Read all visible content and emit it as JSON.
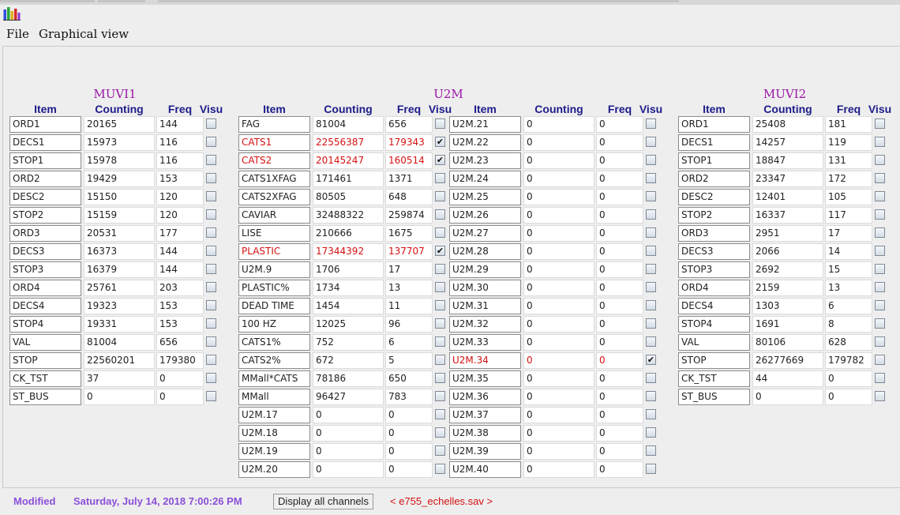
{
  "menu": {
    "file": "File",
    "graphical_view": "Graphical view"
  },
  "col_headers": {
    "item": "Item",
    "counting": "Counting",
    "freq": "Freq",
    "visu": "Visu"
  },
  "sections": [
    {
      "title": "MUVI1",
      "groups": [
        {
          "rows": [
            {
              "item": "ORD1",
              "counting": "20165",
              "freq": "144",
              "checked": false,
              "red": false
            },
            {
              "item": "DECS1",
              "counting": "15973",
              "freq": "116",
              "checked": false,
              "red": false
            },
            {
              "item": "STOP1",
              "counting": "15978",
              "freq": "116",
              "checked": false,
              "red": false
            },
            {
              "item": "ORD2",
              "counting": "19429",
              "freq": "153",
              "checked": false,
              "red": false
            },
            {
              "item": "DESC2",
              "counting": "15150",
              "freq": "120",
              "checked": false,
              "red": false
            },
            {
              "item": "STOP2",
              "counting": "15159",
              "freq": "120",
              "checked": false,
              "red": false
            },
            {
              "item": "ORD3",
              "counting": "20531",
              "freq": "177",
              "checked": false,
              "red": false
            },
            {
              "item": "DECS3",
              "counting": "16373",
              "freq": "144",
              "checked": false,
              "red": false
            },
            {
              "item": "STOP3",
              "counting": "16379",
              "freq": "144",
              "checked": false,
              "red": false
            },
            {
              "item": "ORD4",
              "counting": "25761",
              "freq": "203",
              "checked": false,
              "red": false
            },
            {
              "item": "DECS4",
              "counting": "19323",
              "freq": "153",
              "checked": false,
              "red": false
            },
            {
              "item": "STOP4",
              "counting": "19331",
              "freq": "153",
              "checked": false,
              "red": false
            },
            {
              "item": "VAL",
              "counting": "81004",
              "freq": "656",
              "checked": false,
              "red": false
            },
            {
              "item": "STOP",
              "counting": "22560201",
              "freq": "179380",
              "checked": false,
              "red": false
            },
            {
              "item": "CK_TST",
              "counting": "37",
              "freq": "0",
              "checked": false,
              "red": false
            },
            {
              "item": "ST_BUS",
              "counting": "0",
              "freq": "0",
              "checked": false,
              "red": false
            }
          ]
        }
      ]
    },
    {
      "title": "U2M",
      "groups": [
        {
          "rows": [
            {
              "item": "FAG",
              "counting": "81004",
              "freq": "656",
              "checked": false,
              "red": false
            },
            {
              "item": "CATS1",
              "counting": "22556387",
              "freq": "179343",
              "checked": true,
              "red": true
            },
            {
              "item": "CATS2",
              "counting": "20145247",
              "freq": "160514",
              "checked": true,
              "red": true
            },
            {
              "item": "CATS1XFAG",
              "counting": "171461",
              "freq": "1371",
              "checked": false,
              "red": false
            },
            {
              "item": "CATS2XFAG",
              "counting": "80505",
              "freq": "648",
              "checked": false,
              "red": false
            },
            {
              "item": "CAVIAR",
              "counting": "32488322",
              "freq": "259874",
              "checked": false,
              "red": false
            },
            {
              "item": "LISE",
              "counting": "210666",
              "freq": "1675",
              "checked": false,
              "red": false
            },
            {
              "item": "PLASTIC",
              "counting": "17344392",
              "freq": "137707",
              "checked": true,
              "red": true
            },
            {
              "item": "U2M.9",
              "counting": "1706",
              "freq": "17",
              "checked": false,
              "red": false
            },
            {
              "item": "PLASTIC%",
              "counting": "1734",
              "freq": "13",
              "checked": false,
              "red": false
            },
            {
              "item": "DEAD TIME",
              "counting": "1454",
              "freq": "11",
              "checked": false,
              "red": false
            },
            {
              "item": "100 HZ",
              "counting": "12025",
              "freq": "96",
              "checked": false,
              "red": false
            },
            {
              "item": "CATS1%",
              "counting": "752",
              "freq": "6",
              "checked": false,
              "red": false
            },
            {
              "item": "CATS2%",
              "counting": "672",
              "freq": "5",
              "checked": false,
              "red": false
            },
            {
              "item": "MMall*CATS",
              "counting": "78186",
              "freq": "650",
              "checked": false,
              "red": false
            },
            {
              "item": "MMall",
              "counting": "96427",
              "freq": "783",
              "checked": false,
              "red": false
            },
            {
              "item": "U2M.17",
              "counting": "0",
              "freq": "0",
              "checked": false,
              "red": false
            },
            {
              "item": "U2M.18",
              "counting": "0",
              "freq": "0",
              "checked": false,
              "red": false
            },
            {
              "item": "U2M.19",
              "counting": "0",
              "freq": "0",
              "checked": false,
              "red": false
            },
            {
              "item": "U2M.20",
              "counting": "0",
              "freq": "0",
              "checked": false,
              "red": false
            }
          ]
        },
        {
          "rows": [
            {
              "item": "U2M.21",
              "counting": "0",
              "freq": "0",
              "checked": false,
              "red": false
            },
            {
              "item": "U2M.22",
              "counting": "0",
              "freq": "0",
              "checked": false,
              "red": false
            },
            {
              "item": "U2M.23",
              "counting": "0",
              "freq": "0",
              "checked": false,
              "red": false
            },
            {
              "item": "U2M.24",
              "counting": "0",
              "freq": "0",
              "checked": false,
              "red": false
            },
            {
              "item": "U2M.25",
              "counting": "0",
              "freq": "0",
              "checked": false,
              "red": false
            },
            {
              "item": "U2M.26",
              "counting": "0",
              "freq": "0",
              "checked": false,
              "red": false
            },
            {
              "item": "U2M.27",
              "counting": "0",
              "freq": "0",
              "checked": false,
              "red": false
            },
            {
              "item": "U2M.28",
              "counting": "0",
              "freq": "0",
              "checked": false,
              "red": false
            },
            {
              "item": "U2M.29",
              "counting": "0",
              "freq": "0",
              "checked": false,
              "red": false
            },
            {
              "item": "U2M.30",
              "counting": "0",
              "freq": "0",
              "checked": false,
              "red": false
            },
            {
              "item": "U2M.31",
              "counting": "0",
              "freq": "0",
              "checked": false,
              "red": false
            },
            {
              "item": "U2M.32",
              "counting": "0",
              "freq": "0",
              "checked": false,
              "red": false
            },
            {
              "item": "U2M.33",
              "counting": "0",
              "freq": "0",
              "checked": false,
              "red": false
            },
            {
              "item": "U2M.34",
              "counting": "0",
              "freq": "0",
              "checked": true,
              "red": true
            },
            {
              "item": "U2M.35",
              "counting": "0",
              "freq": "0",
              "checked": false,
              "red": false
            },
            {
              "item": "U2M.36",
              "counting": "0",
              "freq": "0",
              "checked": false,
              "red": false
            },
            {
              "item": "U2M.37",
              "counting": "0",
              "freq": "0",
              "checked": false,
              "red": false
            },
            {
              "item": "U2M.38",
              "counting": "0",
              "freq": "0",
              "checked": false,
              "red": false
            },
            {
              "item": "U2M.39",
              "counting": "0",
              "freq": "0",
              "checked": false,
              "red": false
            },
            {
              "item": "U2M.40",
              "counting": "0",
              "freq": "0",
              "checked": false,
              "red": false
            }
          ]
        }
      ]
    },
    {
      "title": "MUVI2",
      "groups": [
        {
          "rows": [
            {
              "item": "ORD1",
              "counting": "25408",
              "freq": "181",
              "checked": false,
              "red": false
            },
            {
              "item": "DECS1",
              "counting": "14257",
              "freq": "119",
              "checked": false,
              "red": false
            },
            {
              "item": "STOP1",
              "counting": "18847",
              "freq": "131",
              "checked": false,
              "red": false
            },
            {
              "item": "ORD2",
              "counting": "23347",
              "freq": "172",
              "checked": false,
              "red": false
            },
            {
              "item": "DESC2",
              "counting": "12401",
              "freq": "105",
              "checked": false,
              "red": false
            },
            {
              "item": "STOP2",
              "counting": "16337",
              "freq": "117",
              "checked": false,
              "red": false
            },
            {
              "item": "ORD3",
              "counting": "2951",
              "freq": "17",
              "checked": false,
              "red": false
            },
            {
              "item": "DECS3",
              "counting": "2066",
              "freq": "14",
              "checked": false,
              "red": false
            },
            {
              "item": "STOP3",
              "counting": "2692",
              "freq": "15",
              "checked": false,
              "red": false
            },
            {
              "item": "ORD4",
              "counting": "2159",
              "freq": "13",
              "checked": false,
              "red": false
            },
            {
              "item": "DECS4",
              "counting": "1303",
              "freq": "6",
              "checked": false,
              "red": false
            },
            {
              "item": "STOP4",
              "counting": "1691",
              "freq": "8",
              "checked": false,
              "red": false
            },
            {
              "item": "VAL",
              "counting": "80106",
              "freq": "628",
              "checked": false,
              "red": false
            },
            {
              "item": "STOP",
              "counting": "26277669",
              "freq": "179782",
              "checked": false,
              "red": false
            },
            {
              "item": "CK_TST",
              "counting": "44",
              "freq": "0",
              "checked": false,
              "red": false
            },
            {
              "item": "ST_BUS",
              "counting": "0",
              "freq": "0",
              "checked": false,
              "red": false
            }
          ]
        }
      ]
    }
  ],
  "status": {
    "modified": "Modified",
    "datetime": "Saturday, July 14, 2018 7:00:26 PM",
    "display_all": "Display all channels",
    "filename": "< e755_echelles.sav >"
  },
  "colors": {
    "section_title": "#9c16a8",
    "column_header": "#1c1c8a",
    "active_value": "#d51111",
    "status_purple": "#8a4fd8",
    "filename": "#d51111"
  },
  "icons": {
    "app": "bar-chart-icon",
    "checkbox_mark": "✔"
  }
}
